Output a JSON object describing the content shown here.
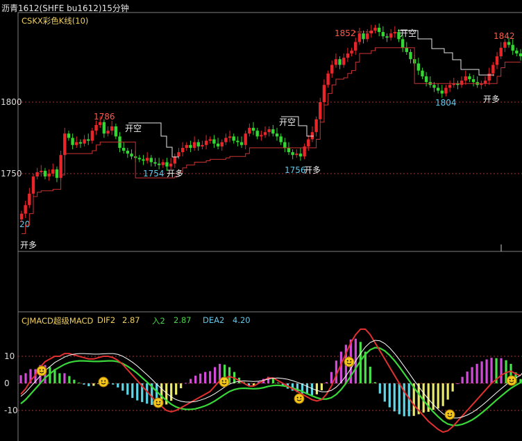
{
  "header": {
    "title": "沥青1612(SHFE bu1612)15分钟"
  },
  "price_panel": {
    "indicator_name": "CSKX彩色K线(10)",
    "axis": {
      "ticks": [
        "1800",
        "1750"
      ],
      "partial_tick": "20"
    }
  },
  "macd_panel": {
    "indicator_name": "CJMACD超级MACD",
    "dif_label": "DIF2",
    "dif_value": "2.87",
    "entry_label": "入2",
    "entry_value": "2.87",
    "dea_label": "DEA2",
    "dea_value": "4.20",
    "axis": {
      "ticks": [
        "10",
        "0",
        "-10"
      ]
    }
  },
  "colors": {
    "up_candle": "#e8262a",
    "down_candle": "#33d633",
    "neutral_candle": "#f3e06a",
    "stop_line": "#cc3333",
    "short_stop_line": "#e8e8e8",
    "dif_line": "#e03030",
    "dea_line": "#3ad83a",
    "signal_line": "#ffffff",
    "hist_pos": "#d24bd8",
    "hist_pos_alt": "#49e049",
    "hist_neg": "#5fd6e6",
    "hist_neg_alt": "#eaea6a",
    "grid": "#b03030",
    "title": "#e6e6e6",
    "indicator": "#f0d060",
    "dea_label": "#63c8e8"
  },
  "annotations": [
    {
      "text": "开多",
      "kind": "long"
    },
    {
      "text": "1786",
      "kind": "high"
    },
    {
      "text": "开空",
      "kind": "short"
    },
    {
      "text": "1754",
      "kind": "low"
    },
    {
      "text": "开多",
      "kind": "long"
    },
    {
      "text": "开空",
      "kind": "short"
    },
    {
      "text": "1756",
      "kind": "low"
    },
    {
      "text": "开多",
      "kind": "long"
    },
    {
      "text": "1852",
      "kind": "high"
    },
    {
      "text": "开空",
      "kind": "short"
    },
    {
      "text": "1804",
      "kind": "low"
    },
    {
      "text": "1842",
      "kind": "high"
    },
    {
      "text": "开多",
      "kind": "long"
    }
  ],
  "chart_data": {
    "type": "candlestick",
    "title": "沥青1612(SHFE bu1612)15分钟",
    "y_ticks": [
      1750,
      1800
    ],
    "ohlc_close_path": [
      1722,
      1728,
      1736,
      1748,
      1751,
      1752,
      1748,
      1750,
      1753,
      1747,
      1763,
      1778,
      1775,
      1770,
      1772,
      1771,
      1774,
      1773,
      1780,
      1784,
      1786,
      1778,
      1780,
      1783,
      1776,
      1768,
      1766,
      1764,
      1762,
      1761,
      1760,
      1759,
      1761,
      1758,
      1757,
      1756,
      1758,
      1755,
      1757,
      1762,
      1765,
      1768,
      1770,
      1768,
      1772,
      1769,
      1770,
      1773,
      1774,
      1771,
      1769,
      1772,
      1775,
      1776,
      1773,
      1772,
      1770,
      1778,
      1782,
      1780,
      1776,
      1777,
      1779,
      1781,
      1778,
      1776,
      1772,
      1768,
      1765,
      1763,
      1764,
      1762,
      1769,
      1774,
      1779,
      1788,
      1800,
      1812,
      1820,
      1826,
      1830,
      1826,
      1831,
      1834,
      1836,
      1842,
      1848,
      1844,
      1848,
      1850,
      1852,
      1849,
      1846,
      1845,
      1848,
      1849,
      1844,
      1838,
      1835,
      1830,
      1827,
      1822,
      1818,
      1814,
      1812,
      1810,
      1808,
      1806,
      1810,
      1812,
      1813,
      1812,
      1815,
      1818,
      1816,
      1814,
      1812,
      1813,
      1815,
      1820,
      1826,
      1832,
      1838,
      1842,
      1840,
      1836,
      1834,
      1832
    ],
    "macd": {
      "dif_last": 2.87,
      "dea_last": 4.2,
      "y_ticks": [
        10,
        0,
        -10
      ],
      "dif": [
        -4,
        -2,
        1,
        3,
        6,
        8,
        9,
        10,
        10,
        11,
        11,
        10.5,
        10,
        9.5,
        9,
        9,
        9.5,
        10,
        10,
        9.5,
        8.5,
        7,
        5,
        3,
        1,
        -1,
        -3,
        -5,
        -7,
        -8.5,
        -10,
        -10.5,
        -10,
        -9,
        -8,
        -7,
        -6,
        -5,
        -4,
        -3,
        -1,
        1,
        2,
        2.5,
        2,
        1,
        0,
        -1,
        -1,
        0,
        1,
        2,
        2,
        1,
        0,
        -1,
        -2,
        -3,
        -4,
        -5,
        -6,
        -6.5,
        -6,
        -4,
        -1,
        3,
        7,
        11,
        15,
        18,
        20,
        20,
        18,
        15,
        12,
        9,
        6,
        3,
        0,
        -3,
        -5.5,
        -8,
        -10,
        -12,
        -14,
        -15.5,
        -17,
        -18,
        -17.5,
        -16,
        -14,
        -12,
        -10,
        -8,
        -6,
        -4,
        -2,
        0,
        1.5,
        3,
        4,
        4.5,
        3.5,
        2.87
      ],
      "dea": [
        -6,
        -4.5,
        -2.5,
        -0.5,
        1.5,
        3.5,
        5,
        6.5,
        7.5,
        8.5,
        9.2,
        9.6,
        9.8,
        9.8,
        9.7,
        9.6,
        9.6,
        9.7,
        9.8,
        9.8,
        9.5,
        8.8,
        7.8,
        6.6,
        5.2,
        3.6,
        2,
        0.3,
        -1.5,
        -3.2,
        -4.8,
        -6.2,
        -7.2,
        -7.8,
        -8.1,
        -8.1,
        -7.9,
        -7.4,
        -6.8,
        -6,
        -5,
        -3.8,
        -2.6,
        -1.5,
        -0.8,
        -0.4,
        -0.3,
        -0.4,
        -0.5,
        -0.4,
        -0.1,
        0.4,
        0.7,
        0.8,
        0.6,
        0.3,
        -0.2,
        -0.8,
        -1.5,
        -2.3,
        -3.1,
        -3.8,
        -4.3,
        -4.3,
        -3.8,
        -2.6,
        -0.8,
        1.5,
        4.2,
        7,
        9.8,
        12.2,
        13.9,
        14.7,
        14.5,
        13.5,
        11.9,
        9.9,
        7.6,
        5.1,
        2.6,
        0,
        -2.4,
        -4.8,
        -7,
        -9,
        -10.8,
        -12.4,
        -13.5,
        -14,
        -14,
        -13.6,
        -12.9,
        -12,
        -10.8,
        -9.4,
        -7.9,
        -6.3,
        -4.7,
        -3.2,
        -1.7,
        -0.3,
        0.8,
        1.8,
        4.2
      ]
    }
  }
}
